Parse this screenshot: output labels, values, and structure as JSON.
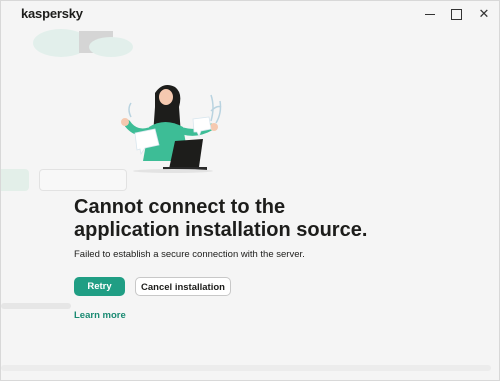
{
  "app": {
    "logo_text": "kaspersky"
  },
  "window_controls": {
    "minimize": "minimize",
    "maximize": "maximize",
    "close": "close"
  },
  "dialog": {
    "title": "Cannot connect to the application installation source.",
    "message": "Failed to establish a secure connection with the server.",
    "retry_label": "Retry",
    "cancel_label": "Cancel installation",
    "learn_more_label": "Learn more"
  },
  "colors": {
    "accent": "#209e84",
    "link": "#1a8a72",
    "background": "#f5f5f5"
  }
}
